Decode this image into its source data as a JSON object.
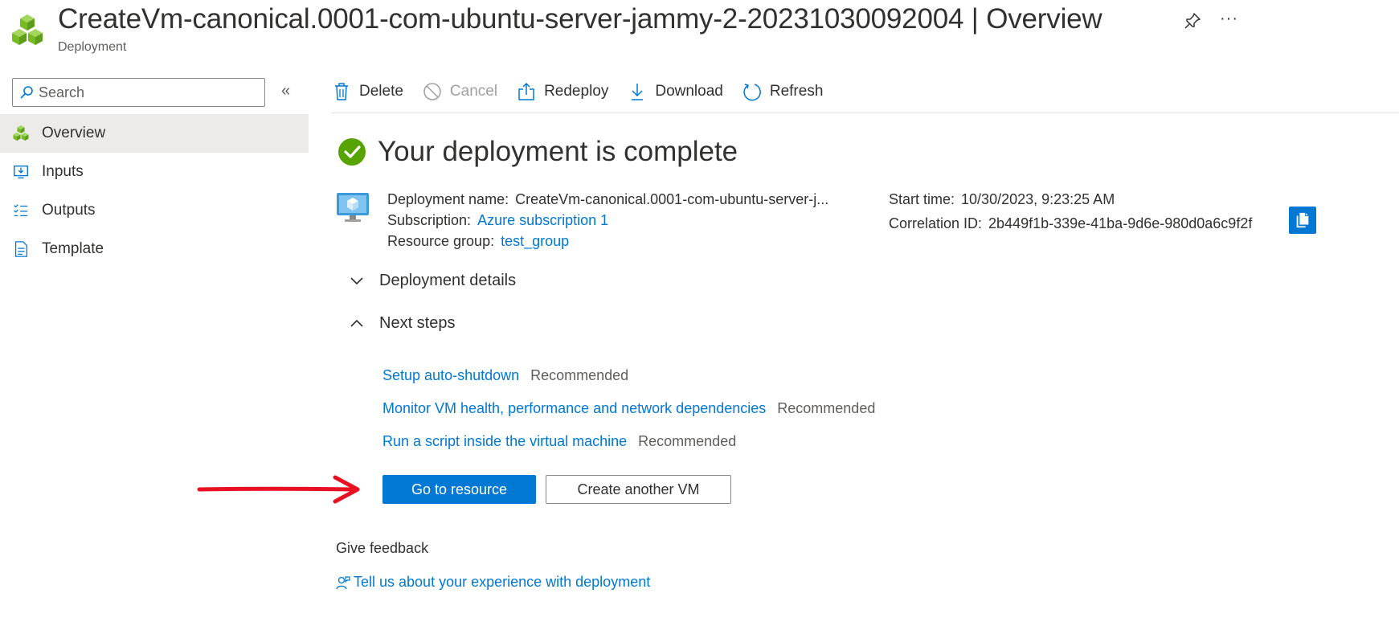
{
  "header": {
    "title": "CreateVm-canonical.0001-com-ubuntu-server-jammy-2-20231030092004",
    "separator": "|",
    "blade": "Overview",
    "subtitle": "Deployment",
    "resource_icon": "deployment-cubes-icon",
    "more_label": "···"
  },
  "sidebar": {
    "search": {
      "placeholder": "Search",
      "value": ""
    },
    "collapse_label": "«",
    "items": [
      {
        "label": "Overview",
        "icon": "deployment-cubes-icon",
        "active": true
      },
      {
        "label": "Inputs",
        "icon": "inputs-icon",
        "active": false
      },
      {
        "label": "Outputs",
        "icon": "outputs-icon",
        "active": false
      },
      {
        "label": "Template",
        "icon": "template-icon",
        "active": false
      }
    ]
  },
  "toolbar": {
    "delete_label": "Delete",
    "cancel_label": "Cancel",
    "redeploy_label": "Redeploy",
    "download_label": "Download",
    "refresh_label": "Refresh"
  },
  "main": {
    "status_title": "Your deployment is complete",
    "details": {
      "deployment_name_label": "Deployment name:",
      "deployment_name_value": "CreateVm-canonical.0001-com-ubuntu-server-j...",
      "subscription_label": "Subscription:",
      "subscription_value": "Azure subscription 1",
      "resource_group_label": "Resource group:",
      "resource_group_value": "test_group",
      "start_time_label": "Start time:",
      "start_time_value": "10/30/2023, 9:23:25 AM",
      "correlation_label": "Correlation ID:",
      "correlation_value": "2b449f1b-339e-41ba-9d6e-980d0a6c9f2f"
    },
    "sections": {
      "deployment_details": "Deployment details",
      "next_steps": "Next steps"
    },
    "next_steps": [
      {
        "link": "Setup auto-shutdown",
        "tag": "Recommended"
      },
      {
        "link": "Monitor VM health, performance and network dependencies",
        "tag": "Recommended"
      },
      {
        "link": "Run a script inside the virtual machine",
        "tag": "Recommended"
      }
    ],
    "buttons": {
      "go_to_resource": "Go to resource",
      "create_another": "Create another VM"
    },
    "feedback": {
      "title": "Give feedback",
      "link": "Tell us about your experience with deployment"
    }
  },
  "colors": {
    "accent": "#0078d4",
    "success": "#57a300",
    "annotation": "#e81123"
  }
}
